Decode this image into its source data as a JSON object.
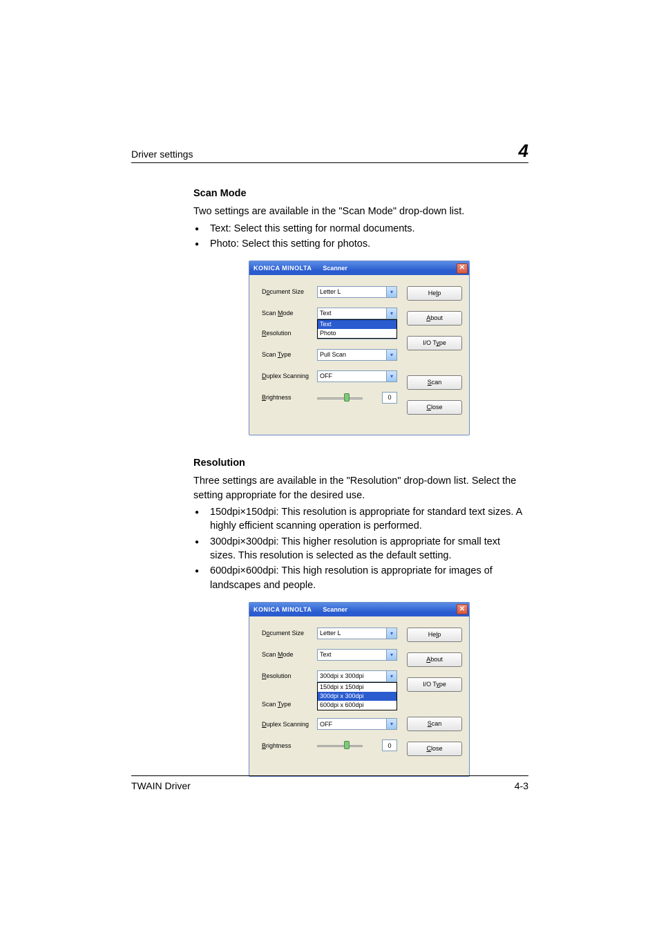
{
  "header": {
    "left": "Driver settings",
    "right": "4"
  },
  "s1": {
    "heading": "Scan Mode",
    "intro": "Two settings are available in the \"Scan Mode\" drop-down list.",
    "bul": [
      "Text: Select this setting for normal documents.",
      "Photo: Select this setting for photos."
    ]
  },
  "s2": {
    "heading": "Resolution",
    "intro": "Three settings are available in the \"Resolution\" drop-down list. Select the setting appropriate for the desired use.",
    "bul": [
      "150dpi×150dpi: This resolution is appropriate for standard text sizes. A highly efficient scanning operation is performed.",
      "300dpi×300dpi: This higher resolution is appropriate for small text sizes. This resolution is selected as the default setting.",
      "600dpi×600dpi: This high resolution is appropriate for images of landscapes and people."
    ]
  },
  "dlg": {
    "brand": "KONICA MINOLTA",
    "title": "Scanner",
    "labels": {
      "docsize": "Document Size",
      "scanmode": "Scan Mode",
      "resolution": "Resolution",
      "scantype": "Scan Type",
      "duplex": "Duplex Scanning",
      "brightness": "Brightness"
    },
    "vals": {
      "docsize": "Letter L",
      "scanmode": "Text",
      "resolution": "300dpi x 300dpi",
      "scantype": "Pull Scan",
      "duplex": "OFF",
      "brightness": "0"
    },
    "scanmode_opts": {
      "text": "Text",
      "photo": "Photo"
    },
    "res_opts": {
      "r150": "150dpi x 150dpi",
      "r300": "300dpi x 300dpi",
      "r600": "600dpi x 600dpi"
    },
    "btns": {
      "help": "Help",
      "about": "About",
      "iotype": "I/O Type",
      "scan": "Scan",
      "close": "Close"
    }
  },
  "footer": {
    "left": "TWAIN Driver",
    "right": "4-3"
  }
}
